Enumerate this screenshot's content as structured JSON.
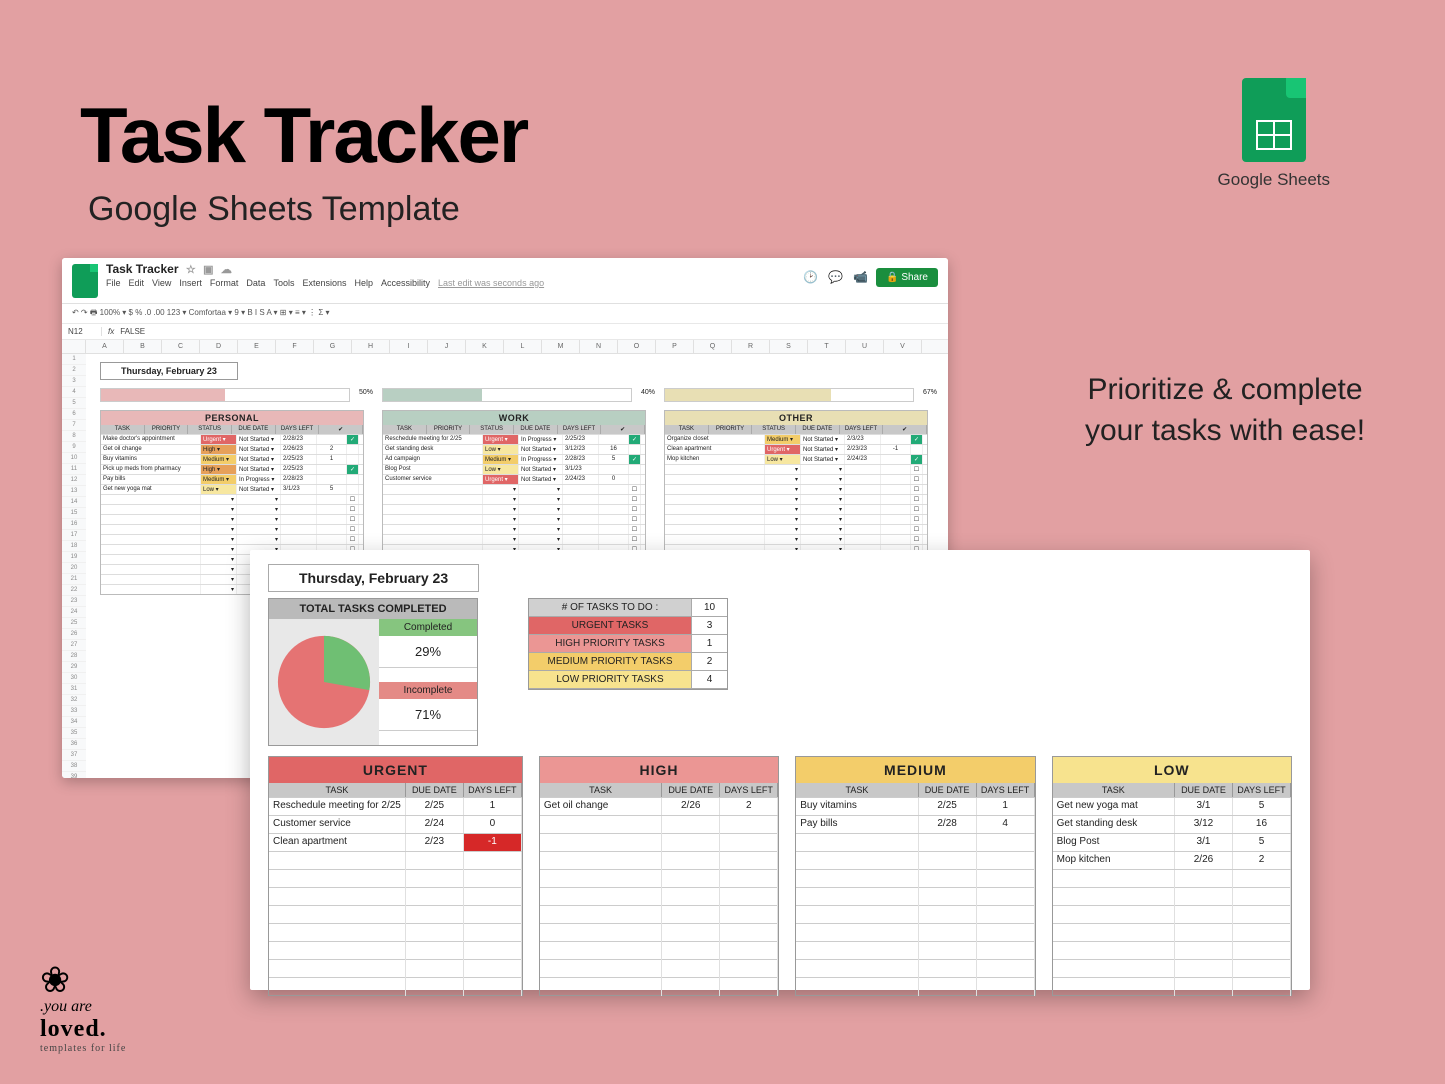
{
  "hero": {
    "title": "Task Tracker",
    "subtitle": "Google Sheets Template"
  },
  "badge": {
    "label": "Google Sheets"
  },
  "tagline": "Prioritize & complete your tasks with ease!",
  "brand": {
    "line1": ".you are",
    "line2": "loved.",
    "line3": "templates for life"
  },
  "sheet": {
    "doc_title": "Task Tracker",
    "menus": [
      "File",
      "Edit",
      "View",
      "Insert",
      "Format",
      "Data",
      "Tools",
      "Extensions",
      "Help",
      "Accessibility"
    ],
    "last_edit": "Last edit was seconds ago",
    "share": "Share",
    "toolbar": "↶ ↷ 🖶 100% ▾ $ % .0 .00 123 ▾ Comfortaa ▾ 9 ▾ B I S A ▾ ⊞ ▾ ≡ ▾ ⋮ Σ ▾",
    "ref_cell": "N12",
    "ref_val": "FALSE",
    "cols": [
      "A",
      "B",
      "C",
      "D",
      "E",
      "F",
      "G",
      "H",
      "I",
      "J",
      "K",
      "L",
      "M",
      "N",
      "O",
      "P",
      "Q",
      "R",
      "S",
      "T",
      "U",
      "V"
    ],
    "date": "Thursday, February 23",
    "progress": {
      "personal": "50%",
      "work": "40%",
      "other": "67%"
    },
    "sections": {
      "personal": {
        "title": "PERSONAL",
        "headers": [
          "TASK",
          "PRIORITY",
          "STATUS",
          "DUE DATE",
          "DAYS LEFT",
          "✔"
        ],
        "rows": [
          {
            "task": "Make doctor's appointment",
            "pri": "Urgent",
            "stat": "Not Started",
            "due": "2/28/23",
            "left": "",
            "ck": true
          },
          {
            "task": "Get oil change",
            "pri": "High",
            "stat": "Not Started",
            "due": "2/26/23",
            "left": "2",
            "ck": false
          },
          {
            "task": "Buy vitamins",
            "pri": "Medium",
            "stat": "Not Started",
            "due": "2/25/23",
            "left": "1",
            "ck": false
          },
          {
            "task": "Pick up meds from pharmacy",
            "pri": "High",
            "stat": "Not Started",
            "due": "2/25/23",
            "left": "",
            "ck": true
          },
          {
            "task": "Pay bills",
            "pri": "Medium",
            "stat": "In Progress",
            "due": "2/28/23",
            "left": "",
            "ck": false
          },
          {
            "task": "Get new yoga mat",
            "pri": "Low",
            "stat": "Not Started",
            "due": "3/1/23",
            "left": "5",
            "ck": false
          }
        ]
      },
      "work": {
        "title": "WORK",
        "headers": [
          "TASK",
          "PRIORITY",
          "STATUS",
          "DUE DATE",
          "DAYS LEFT",
          "✔"
        ],
        "rows": [
          {
            "task": "Reschedule meeting for 2/25",
            "pri": "Urgent",
            "stat": "In Progress",
            "due": "2/25/23",
            "left": "",
            "ck": true
          },
          {
            "task": "Get standing desk",
            "pri": "Low",
            "stat": "Not Started",
            "due": "3/12/23",
            "left": "16",
            "ck": false
          },
          {
            "task": "Ad campaign",
            "pri": "Medium",
            "stat": "In Progress",
            "due": "2/28/23",
            "left": "5",
            "ck": true
          },
          {
            "task": "Blog Post",
            "pri": "Low",
            "stat": "Not Started",
            "due": "3/1/23",
            "left": "",
            "ck": false
          },
          {
            "task": "Customer service",
            "pri": "Urgent",
            "stat": "Not Started",
            "due": "2/24/23",
            "left": "0",
            "ck": false
          }
        ]
      },
      "other": {
        "title": "OTHER",
        "headers": [
          "TASK",
          "PRIORITY",
          "STATUS",
          "DUE DATE",
          "DAYS LEFT",
          "✔"
        ],
        "rows": [
          {
            "task": "Organize closet",
            "pri": "Medium",
            "stat": "Not Started",
            "due": "2/3/23",
            "left": "",
            "ck": true
          },
          {
            "task": "Clean apartment",
            "pri": "Urgent",
            "stat": "Not Started",
            "due": "2/23/23",
            "left": "-1",
            "ck": false
          },
          {
            "task": "Mop kitchen",
            "pri": "Low",
            "stat": "Not Started",
            "due": "2/24/23",
            "left": "",
            "ck": true
          }
        ]
      }
    }
  },
  "chart_data": {
    "type": "pie",
    "title": "TOTAL TASKS COMPLETED",
    "series": [
      {
        "name": "Completed",
        "value": 29,
        "color": "#6fbf73"
      },
      {
        "name": "Incomplete",
        "value": 71,
        "color": "#e57373"
      }
    ]
  },
  "dashboard": {
    "date": "Thursday, February 23",
    "completed_label": "Completed",
    "completed_pct": "29%",
    "incomplete_label": "Incomplete",
    "incomplete_pct": "71%",
    "counts": [
      {
        "label": "# OF TASKS TO DO :",
        "val": "10",
        "cls": "c-todo"
      },
      {
        "label": "URGENT TASKS",
        "val": "3",
        "cls": "c-urg"
      },
      {
        "label": "HIGH PRIORITY TASKS",
        "val": "1",
        "cls": "c-high"
      },
      {
        "label": "MEDIUM PRIORITY TASKS",
        "val": "2",
        "cls": "c-med"
      },
      {
        "label": "LOW PRIORITY TASKS",
        "val": "4",
        "cls": "c-low"
      }
    ],
    "tables": {
      "urgent": {
        "title": "URGENT",
        "cls": "ph-urg",
        "rows": [
          {
            "task": "Reschedule meeting for 2/25",
            "due": "2/25",
            "left": "1"
          },
          {
            "task": "Customer service",
            "due": "2/24",
            "left": "0"
          },
          {
            "task": "Clean apartment",
            "due": "2/23",
            "left": "-1",
            "neg": true
          }
        ]
      },
      "high": {
        "title": "HIGH",
        "cls": "ph-high",
        "rows": [
          {
            "task": "Get oil change",
            "due": "2/26",
            "left": "2"
          }
        ]
      },
      "medium": {
        "title": "MEDIUM",
        "cls": "ph-med",
        "rows": [
          {
            "task": "Buy vitamins",
            "due": "2/25",
            "left": "1"
          },
          {
            "task": "Pay bills",
            "due": "2/28",
            "left": "4"
          }
        ]
      },
      "low": {
        "title": "LOW",
        "cls": "ph-low",
        "rows": [
          {
            "task": "Get new yoga mat",
            "due": "3/1",
            "left": "5"
          },
          {
            "task": "Get standing desk",
            "due": "3/12",
            "left": "16"
          },
          {
            "task": "Blog Post",
            "due": "3/1",
            "left": "5"
          },
          {
            "task": "Mop kitchen",
            "due": "2/26",
            "left": "2"
          }
        ]
      }
    },
    "col_labels": {
      "task": "TASK",
      "due": "DUE DATE",
      "left": "DAYS LEFT"
    }
  }
}
